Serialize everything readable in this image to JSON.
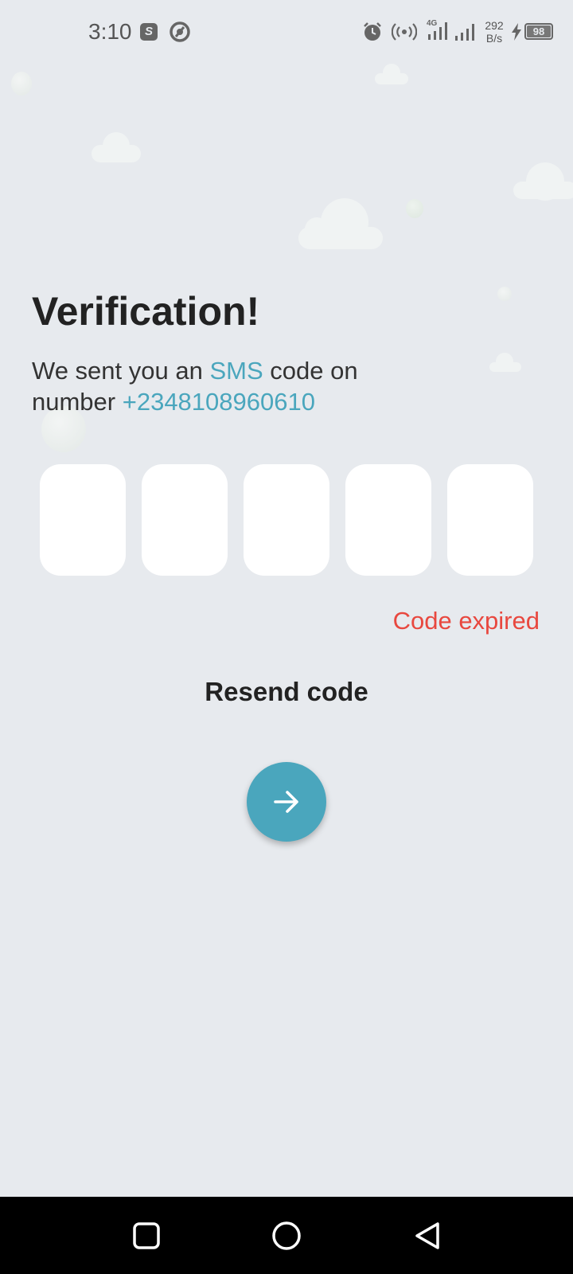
{
  "status_bar": {
    "time": "3:10",
    "s_badge": "S",
    "net_speed_value": "292",
    "net_speed_unit": "B/s",
    "network_type": "4G",
    "battery_level": "98"
  },
  "verification": {
    "title": "Verification!",
    "subtitle_prefix": "We sent you an ",
    "subtitle_sms": "SMS",
    "subtitle_middle": " code on number ",
    "phone_number": "+2348108960610",
    "code_boxes": [
      "",
      "",
      "",
      "",
      ""
    ],
    "error_text": "Code expired",
    "resend_label": "Resend code"
  },
  "colors": {
    "background": "#e7eaee",
    "accent": "#4aa6bd",
    "error": "#e8483f"
  },
  "icons": {
    "fab": "arrow-right-icon",
    "nav": [
      "square-recents-icon",
      "circle-home-icon",
      "triangle-back-icon"
    ]
  }
}
